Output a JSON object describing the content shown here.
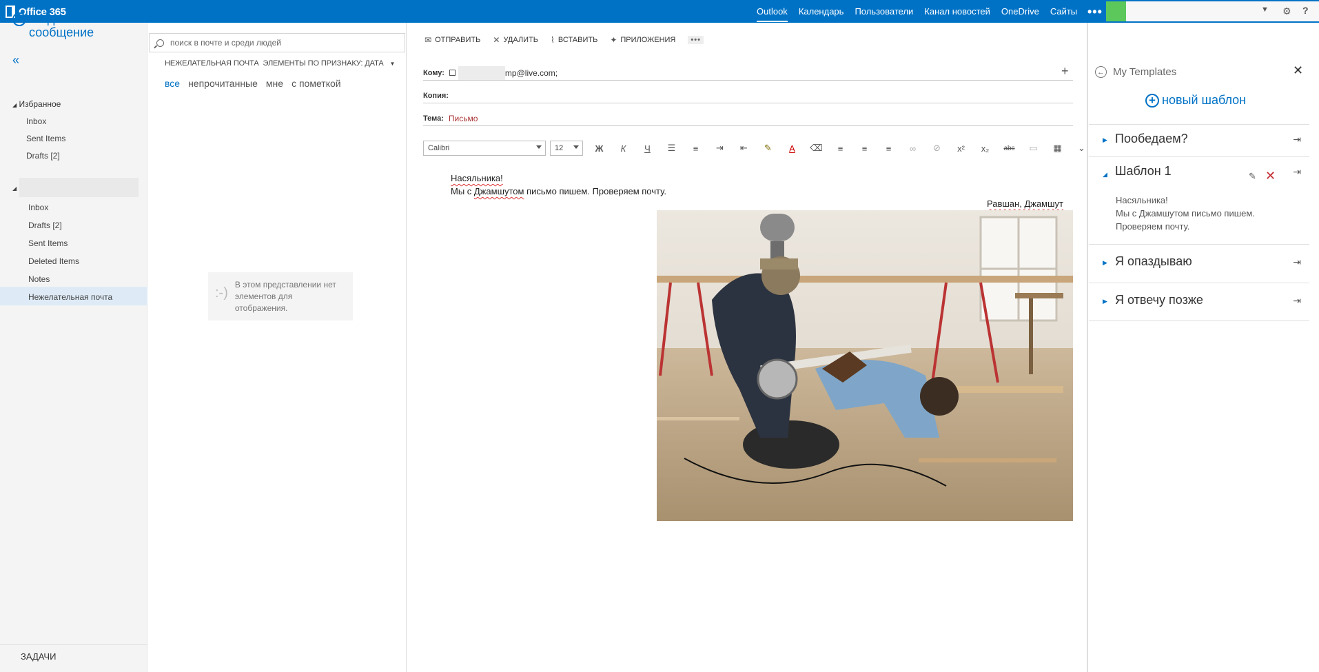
{
  "topbar": {
    "brand": "Office 365",
    "nav": [
      "Outlook",
      "Календарь",
      "Пользователи",
      "Канал новостей",
      "OneDrive",
      "Сайты"
    ],
    "more": "•••",
    "help": "?"
  },
  "leftnav": {
    "new_message": "создать сообщение",
    "collapse": "«",
    "favorites_header": "Избранное",
    "favorites": [
      "Inbox",
      "Sent Items",
      "Drafts [2]"
    ],
    "account_folders": [
      "Inbox",
      "Drafts [2]",
      "Sent Items",
      "Deleted Items",
      "Notes",
      "Нежелательная почта"
    ],
    "selected_folder": "Нежелательная почта",
    "tasks": "ЗАДАЧИ"
  },
  "list": {
    "search_placeholder": "поиск в почте и среди людей",
    "folder_label": "НЕЖЕЛАТЕЛЬНАЯ ПОЧТА  ЭЛЕМЕНТЫ ПО ПРИЗНАКУ: ДАТА",
    "filters": [
      "все",
      "непрочитанные",
      "мне",
      "с пометкой"
    ],
    "empty_face": ":-)",
    "empty_text": "В этом представлении нет элементов для отображения."
  },
  "compose": {
    "toolbar": {
      "send": "ОТПРАВИТЬ",
      "delete": "УДАЛИТЬ",
      "insert": "ВСТАВИТЬ",
      "apps": "ПРИЛОЖЕНИЯ",
      "more": "•••"
    },
    "to_label": "Кому:",
    "to_value": "mp@live.com;",
    "cc_label": "Копия:",
    "subject_label": "Тема:",
    "subject_value": "Письмо",
    "font": "Calibri",
    "size": "12",
    "body_line1": "Насяльника!",
    "body_line2_prefix": "Мы с ",
    "body_line2_name": "Джамшутом",
    "body_line2_suffix": " письмо пишем. Проверяем почту.",
    "signature": "Равшан, Джамшут"
  },
  "templates": {
    "title": "My Templates",
    "new_template": "новый шаблон",
    "items": [
      {
        "name": "Пообедаем?",
        "expanded": false
      },
      {
        "name": "Шаблон 1",
        "expanded": true,
        "text": [
          "Насяльника!",
          "Мы с Джамшутом письмо пишем.",
          "Проверяем почту."
        ]
      },
      {
        "name": "Я опаздываю",
        "expanded": false
      },
      {
        "name": "Я отвечу позже",
        "expanded": false
      }
    ]
  },
  "colors": {
    "accent": "#0072c6",
    "topbar": "#0072c6",
    "selected_folder_bg": "#deebf7",
    "delete_red": "#c1272d"
  }
}
